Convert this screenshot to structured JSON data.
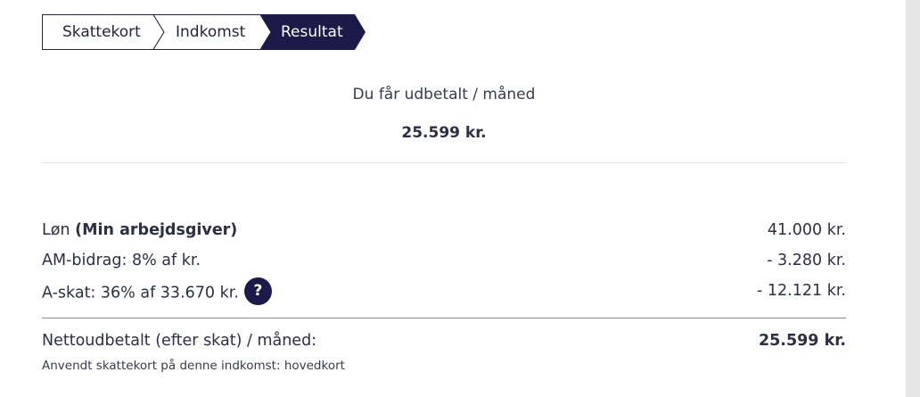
{
  "steps": [
    {
      "label": "Skattekort",
      "active": false
    },
    {
      "label": "Indkomst",
      "active": false
    },
    {
      "label": "Resultat",
      "active": true
    }
  ],
  "summary": {
    "title": "Du får udbetalt / måned",
    "amount": "25.599 kr."
  },
  "lines": [
    {
      "label": "Løn",
      "label_bold": "(Min arbejdsgiver)",
      "value": "41.000 kr."
    },
    {
      "label": "AM-bidrag: 8% af kr.",
      "value": "- 3.280 kr."
    },
    {
      "label": "A-skat: 36% af 33.670 kr.",
      "value": "- 12.121 kr.",
      "help_icon": "question-icon",
      "help_glyph": "?"
    }
  ],
  "net": {
    "label": "Nettoudbetalt (efter skat) / måned:",
    "value": "25.599 kr."
  },
  "note": "Anvendt skattekort på denne indkomst: hovedkort",
  "colors": {
    "accent": "#1b1a48",
    "text": "#2e2e44",
    "background": "#e6e6e6",
    "panel": "#ffffff"
  }
}
